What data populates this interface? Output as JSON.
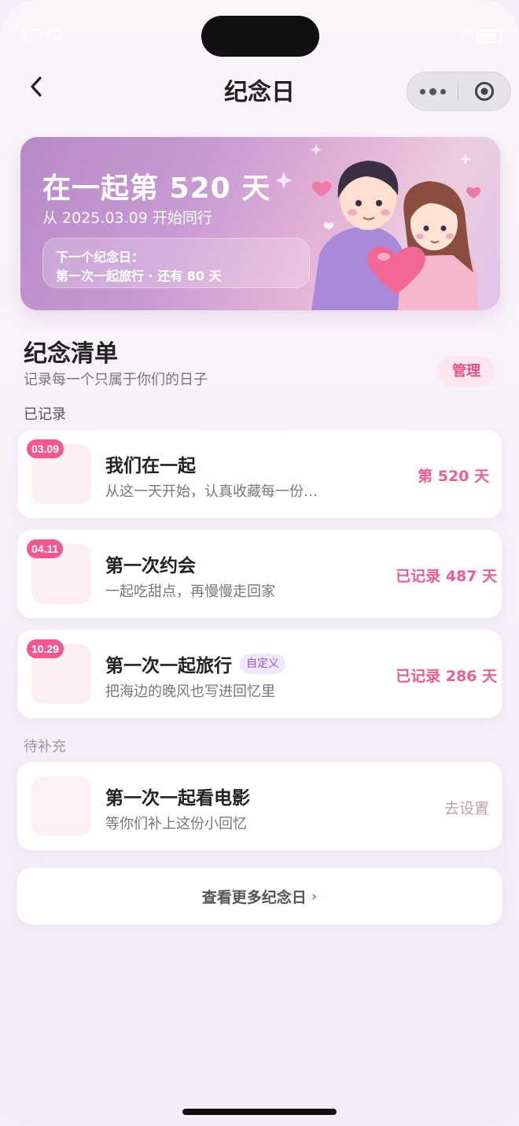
{
  "status_bar": {
    "time": "17:40"
  },
  "nav": {
    "title": "纪念日"
  },
  "banner": {
    "headline": "在一起第 520 天",
    "since": "从 2025.03.09 开始同行",
    "next_label": "下一个纪念日：",
    "next_info": "第一次一起旅行 · 还有 80 天"
  },
  "section": {
    "title": "纪念清单",
    "subtitle": "记录每一个只属于你们的日子",
    "manage_label": "管理"
  },
  "groups": {
    "recorded_label": "已记录",
    "pending_label": "待补充"
  },
  "items": [
    {
      "date": "03.09",
      "title": "我们在一起",
      "desc": "从这一天开始，认真收藏每一份…",
      "stat": "第 520 天"
    },
    {
      "date": "04.11",
      "title": "第一次约会",
      "desc": "一起吃甜点，再慢慢走回家",
      "stat": "已记录 487 天"
    },
    {
      "date": "10.29",
      "title": "第一次一起旅行",
      "tag": "自定义",
      "desc": "把海边的晚风也写进回忆里",
      "stat": "已记录 286 天"
    },
    {
      "title": "第一次一起看电影",
      "desc": "等你们补上这份小回忆",
      "stat": "去设置"
    }
  ],
  "more": {
    "label": "查看更多纪念日",
    "chevron": "›"
  },
  "colors": {
    "accent": "#ec5c95",
    "badge": "#f0588f",
    "tag_text": "#8a5cc7"
  }
}
